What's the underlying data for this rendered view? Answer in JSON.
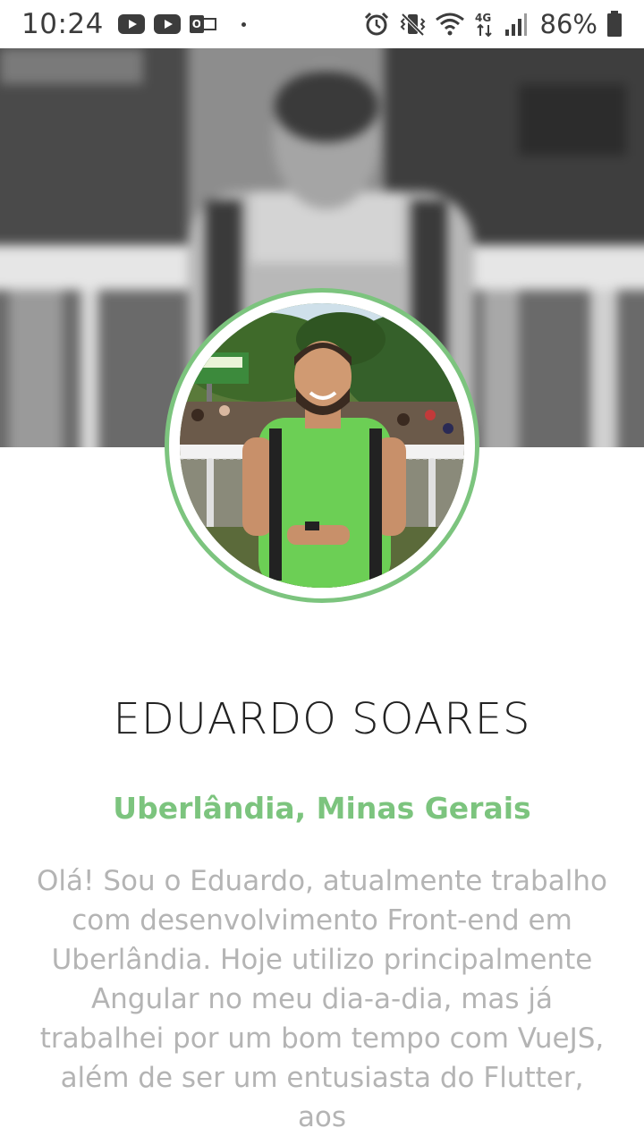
{
  "status_bar": {
    "time": "10:24",
    "battery": "86%",
    "left_icons": [
      "youtube-icon",
      "youtube-icon",
      "outlook-icon",
      "dot-icon"
    ],
    "right_icons": [
      "alarm-icon",
      "vibrate-icon",
      "wifi-icon",
      "4g-icon",
      "signal-icon",
      "battery-icon"
    ]
  },
  "profile": {
    "name": "EDUARDO SOARES",
    "location": "Uberlândia, Minas Gerais",
    "bio": "Olá! Sou o Eduardo, atualmente trabalho com desenvolvimento Front-end em Uberlândia. Hoje utilizo principalmente Angular no meu dia-a-dia, mas já trabalhei por um bom tempo com VueJS, além de ser um entusiasta do Flutter, aos"
  },
  "colors": {
    "accent": "#7cc47e",
    "name_text": "#222222",
    "bio_text": "#b4b4b4"
  }
}
